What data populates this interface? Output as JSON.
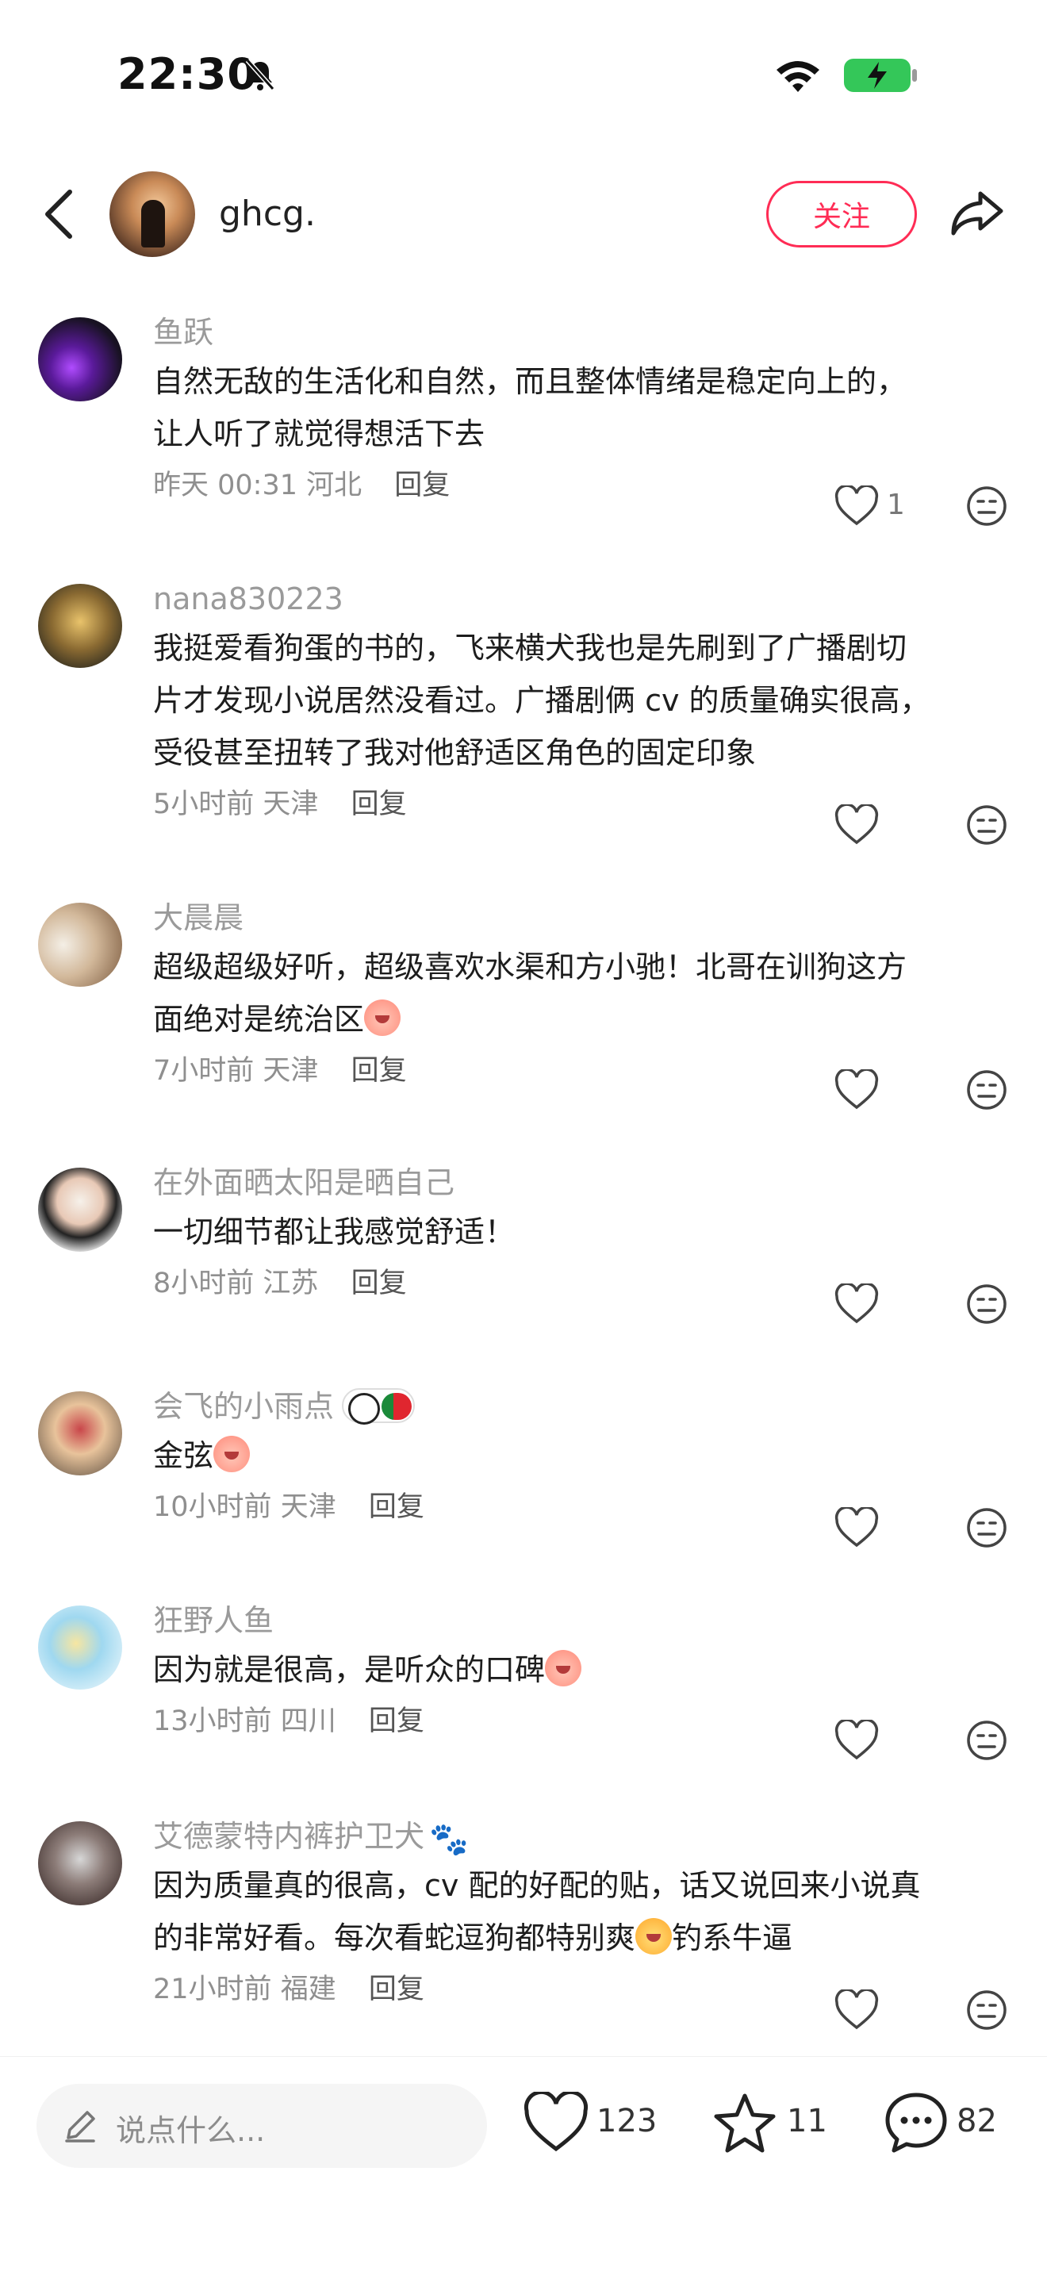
{
  "status_bar": {
    "time": "22:30"
  },
  "header": {
    "username": "ghcg.",
    "follow_label": "关注"
  },
  "comments": [
    {
      "user": "鱼跃",
      "lines": [
        "自然无敌的生活化和自然，而且整体情绪是稳定向上的，",
        "让人听了就觉得想活下去"
      ],
      "time": "昨天 00:31",
      "location": "河北",
      "reply_label": "回复",
      "likes": "1"
    },
    {
      "user": "nana830223",
      "lines": [
        "我挺爱看狗蛋的书的，飞来横犬我也是先刷到了广播剧切",
        "片才发现小说居然没看过。广播剧俩 cv 的质量确实很高，",
        "受役甚至扭转了我对他舒适区角色的固定印象"
      ],
      "time": "5小时前",
      "location": "天津",
      "reply_label": "回复",
      "likes": ""
    },
    {
      "user": "大晨晨",
      "lines": [
        "超级超级好听，超级喜欢水渠和方小驰！北哥在训狗这方",
        "面绝对是统治区"
      ],
      "time": "7小时前",
      "location": "天津",
      "reply_label": "回复",
      "likes": ""
    },
    {
      "user": "在外面晒太阳是晒自己",
      "lines": [
        "一切细节都让我感觉舒适！"
      ],
      "time": "8小时前",
      "location": "江苏",
      "reply_label": "回复",
      "likes": ""
    },
    {
      "user": "会飞的小雨点",
      "lines": [
        "金弦"
      ],
      "time": "10小时前",
      "location": "天津",
      "reply_label": "回复",
      "likes": ""
    },
    {
      "user": "狂野人鱼",
      "lines": [
        "因为就是很高，是听众的口碑"
      ],
      "time": "13小时前",
      "location": "四川",
      "reply_label": "回复",
      "likes": ""
    },
    {
      "user": "艾德蒙特内裤护卫犬",
      "lines": [
        "因为质量真的很高，cv 配的好配的贴，话又说回来小说真",
        "的非常好看。每次看蛇逗狗都特别爽",
        "钓系牛逼"
      ],
      "time": "21小时前",
      "location": "福建",
      "reply_label": "回复",
      "likes": ""
    }
  ],
  "bottom_bar": {
    "input_placeholder": "说点什么...",
    "likes": "123",
    "stars": "11",
    "comments": "82"
  },
  "icons": [
    "bell-slash-icon",
    "wifi-icon",
    "battery-charging-icon",
    "back-arrow-icon",
    "share-icon",
    "heart-icon",
    "dislike-face-icon",
    "pencil-icon",
    "star-icon",
    "chat-bubble-icon"
  ],
  "colors": {
    "accent": "#ff2c55",
    "battery": "#34c759"
  }
}
